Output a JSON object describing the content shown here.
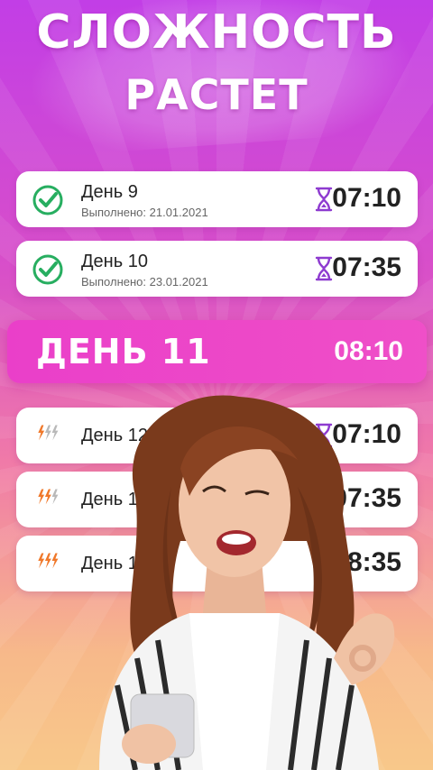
{
  "headline": {
    "line1": "СЛОЖНОСТЬ",
    "line2": "РАСТЕТ"
  },
  "completed_days": [
    {
      "title": "День 9",
      "status": "Выполнено: 21.01.2021",
      "time": "07:10"
    },
    {
      "title": "День 10",
      "status": "Выполнено: 23.01.2021",
      "time": "07:35"
    }
  ],
  "current_day": {
    "title": "ДЕНЬ 11",
    "time": "08:10"
  },
  "upcoming_days": [
    {
      "title": "День 12",
      "time": "07:10",
      "intensity": 1
    },
    {
      "title": "День 1",
      "time": "07:35",
      "intensity": 2
    },
    {
      "title": "День 1",
      "time": "08:35",
      "intensity": 3
    }
  ],
  "colors": {
    "accent": "#ea3fc9",
    "check": "#27ae60",
    "hourglass": "#8e3bd0",
    "bolt_active": "#f0782a",
    "bolt_inactive": "#b9b9b9"
  }
}
